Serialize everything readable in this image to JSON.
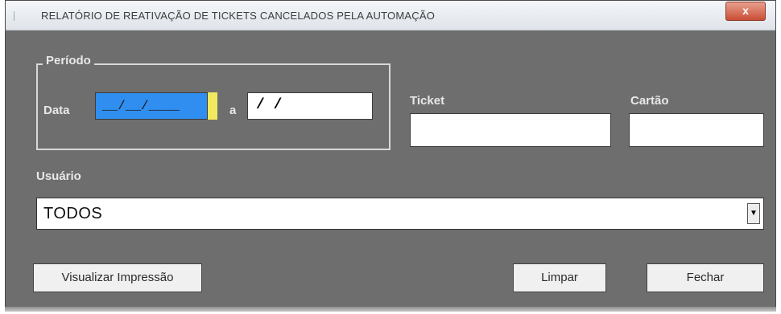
{
  "window": {
    "title": "RELATÓRIO DE REATIVAÇÃO DE TICKETS CANCELADOS PELA AUTOMAÇÃO",
    "close_label": "x"
  },
  "periodo": {
    "legend": "Período",
    "data_label": "Data",
    "date_start_value": "__/__/____",
    "separator_label": "a",
    "date_end_value": " / /"
  },
  "ticket": {
    "label": "Ticket",
    "value": ""
  },
  "cartao": {
    "label": "Cartão",
    "value": ""
  },
  "usuario": {
    "label": "Usuário",
    "selected": "TODOS"
  },
  "buttons": {
    "visualizar": "Visualizar Impressão",
    "limpar": "Limpar",
    "fechar": "Fechar"
  }
}
